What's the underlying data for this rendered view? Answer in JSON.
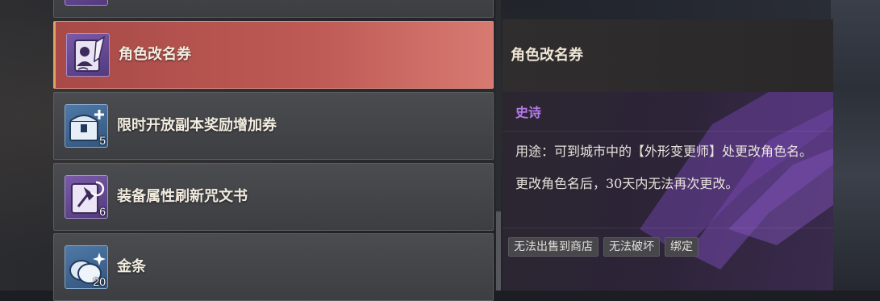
{
  "inventory": {
    "items": [
      {
        "name": "",
        "icon": "scroll-icon",
        "count": "",
        "rarity_color": "#6b4fa0"
      },
      {
        "name": "角色改名券",
        "icon": "rename-scroll-icon",
        "count": "",
        "rarity_color": "#6b4fa0",
        "selected": true
      },
      {
        "name": "限时开放副本奖励增加券",
        "icon": "treasure-chest-icon",
        "count": "5",
        "rarity_color": "#3f6691"
      },
      {
        "name": "装备属性刷新咒文书",
        "icon": "refresh-scroll-icon",
        "count": "6",
        "rarity_color": "#6b4fa0"
      },
      {
        "name": "金条",
        "icon": "gold-bar-icon",
        "count": "20",
        "rarity_color": "#3f6691"
      }
    ]
  },
  "detail": {
    "title": "角色改名券",
    "rarity": "史诗",
    "rarity_color": "#b67ae8",
    "usage": "用途：可到城市中的【外形变更师】处更改角色名。",
    "note": "更改角色名后，30天内无法再次更改。",
    "tags": [
      "无法出售到商店",
      "无法破坏",
      "绑定"
    ]
  },
  "colors": {
    "selected_bg": "#bf5a55",
    "item_bg": "#44464a"
  }
}
